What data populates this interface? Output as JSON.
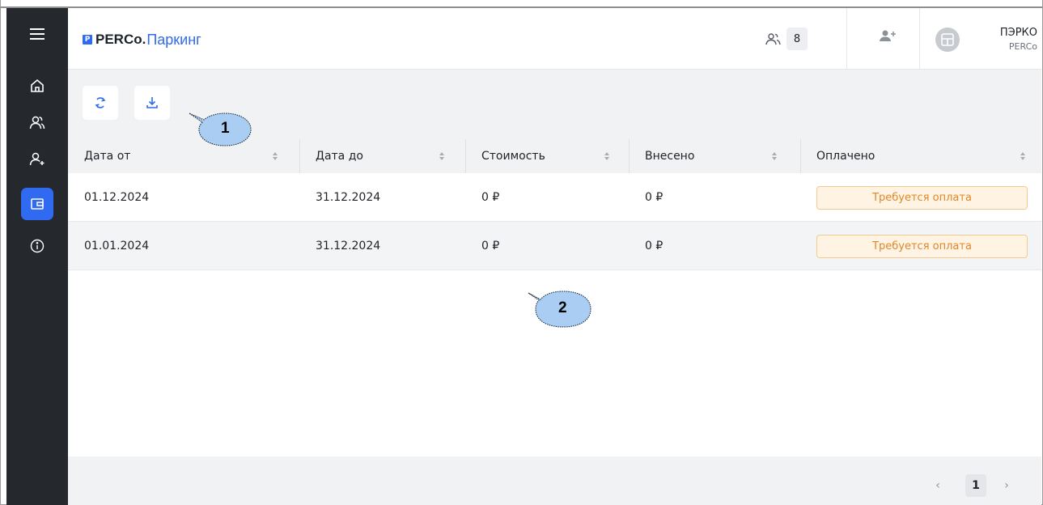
{
  "app": {
    "brand": "PERCo.",
    "product": "Паркинг",
    "logo_letter": "P"
  },
  "header": {
    "online_count": "8",
    "user_name": "ПЭРКО",
    "user_org": "PERCo"
  },
  "sidebar": {
    "items": [
      {
        "icon": "menu-icon"
      },
      {
        "icon": "home-icon"
      },
      {
        "icon": "users-icon"
      },
      {
        "icon": "user-add-icon"
      },
      {
        "icon": "wallet-icon",
        "active": true
      },
      {
        "icon": "info-icon"
      }
    ]
  },
  "toolbar": {
    "refresh_icon": "refresh-icon",
    "download_icon": "download-icon"
  },
  "table": {
    "columns": [
      "Дата от",
      "Дата до",
      "Стоимость",
      "Внесено",
      "Оплачено"
    ],
    "rows": [
      {
        "date_from": "01.12.2024",
        "date_to": "31.12.2024",
        "cost": "0 ₽",
        "paid_in": "0 ₽",
        "status": "Требуется оплата"
      },
      {
        "date_from": "01.01.2024",
        "date_to": "31.12.2024",
        "cost": "0 ₽",
        "paid_in": "0 ₽",
        "status": "Требуется оплата"
      }
    ]
  },
  "pagination": {
    "current_page": "1",
    "prev": "‹",
    "next": "›"
  },
  "callouts": [
    "1",
    "2"
  ],
  "colors": {
    "accent": "#2f6af0",
    "sidebar_bg": "#25282d",
    "status_text": "#e0862b",
    "status_bg": "#fff4e3",
    "callout_fill": "#a9cdf3"
  }
}
